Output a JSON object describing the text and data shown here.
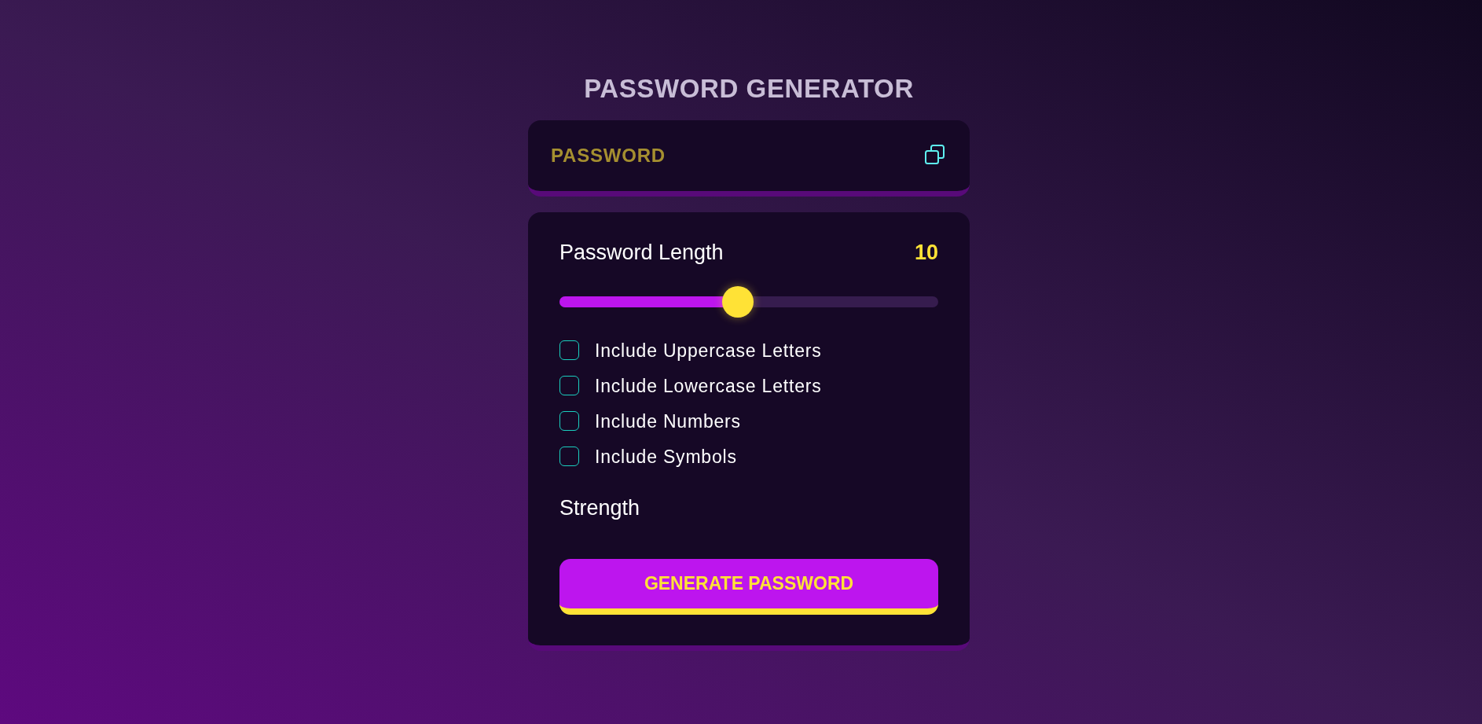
{
  "title": "PASSWORD GENERATOR",
  "output": {
    "placeholder": "PASSWORD"
  },
  "length": {
    "label": "Password Length",
    "value": "10",
    "level": 0.47
  },
  "options": [
    {
      "label": "Include Uppercase Letters",
      "checked": false
    },
    {
      "label": "Include Lowercase Letters",
      "checked": false
    },
    {
      "label": "Include Numbers",
      "checked": false
    },
    {
      "label": "Include Symbols",
      "checked": false
    }
  ],
  "strength": {
    "label": "Strength"
  },
  "button": {
    "label": "GENERATE PASSWORD"
  }
}
